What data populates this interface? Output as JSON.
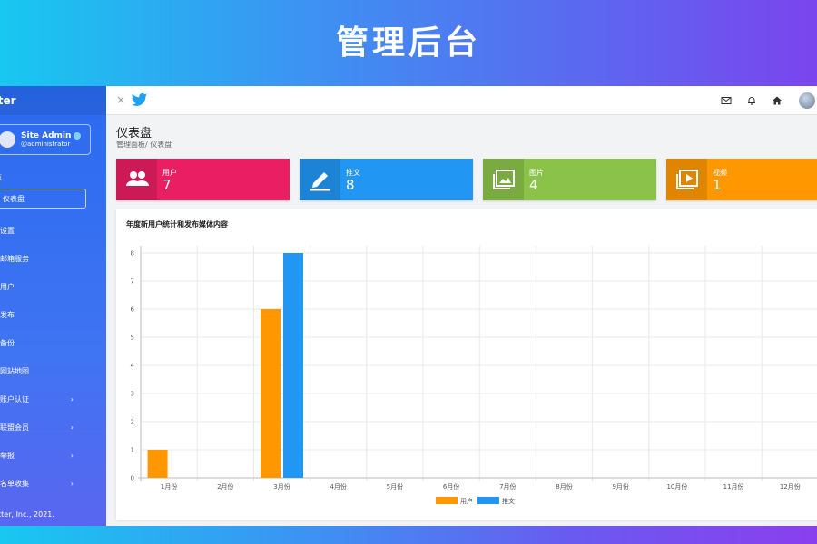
{
  "banner": {
    "title": "管理后台"
  },
  "sidebar": {
    "brand": "tter",
    "profile": {
      "name": "Site Admin",
      "handle": "@administrator"
    },
    "nav_heading": "航",
    "items": [
      {
        "label": "仪表盘",
        "active": true,
        "chevron": false
      },
      {
        "label": "设置",
        "chevron": false
      },
      {
        "label": "邮箱服务",
        "chevron": false
      },
      {
        "label": "用户",
        "chevron": false
      },
      {
        "label": "发布",
        "chevron": false
      },
      {
        "label": "备份",
        "chevron": false
      },
      {
        "label": "网站地图",
        "chevron": false
      },
      {
        "label": "账户认证",
        "chevron": true
      },
      {
        "label": "联盟会员",
        "chevron": true
      },
      {
        "label": "举报",
        "chevron": true
      },
      {
        "label": "名单收集",
        "chevron": true
      }
    ],
    "copyright": "tter, Inc., 2021."
  },
  "topbar": {
    "close": "×"
  },
  "page": {
    "title": "仪表盘",
    "breadcrumb": "管理面板/ 仪表盘"
  },
  "stats": [
    {
      "label": "用户",
      "value": "7",
      "color": "#e91e63",
      "icon": "users-icon"
    },
    {
      "label": "推文",
      "value": "8",
      "color": "#2196f3",
      "icon": "pen-icon"
    },
    {
      "label": "图片",
      "value": "4",
      "color": "#8bc34a",
      "icon": "image-icon"
    },
    {
      "label": "视频",
      "value": "1",
      "color": "#ff9800",
      "icon": "video-icon"
    }
  ],
  "chart_data": {
    "type": "bar",
    "title": "年度新用户统计和发布媒体内容",
    "categories": [
      "1月份",
      "2月份",
      "3月份",
      "4月份",
      "5月份",
      "6月份",
      "7月份",
      "8月份",
      "9月份",
      "10月份",
      "11月份",
      "12月份"
    ],
    "series": [
      {
        "name": "用户",
        "color": "#ff9800",
        "values": [
          1,
          0,
          6,
          0,
          0,
          0,
          0,
          0,
          0,
          0,
          0,
          0
        ]
      },
      {
        "name": "推文",
        "color": "#2196f3",
        "values": [
          0,
          0,
          8,
          0,
          0,
          0,
          0,
          0,
          0,
          0,
          0,
          0
        ]
      }
    ],
    "ylim": [
      0,
      8
    ],
    "yticks": [
      0,
      1,
      2,
      3,
      4,
      5,
      6,
      7,
      8
    ],
    "grid": true,
    "legend": "bottom-center"
  }
}
